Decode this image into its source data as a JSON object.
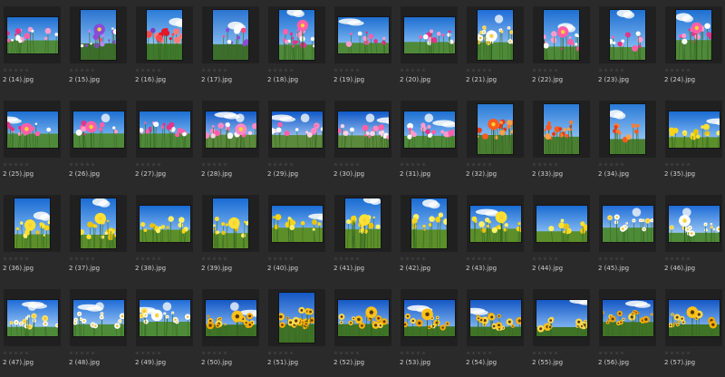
{
  "files": [
    {
      "name": "2 (14).jpg",
      "theme": "cosmos",
      "portrait": false
    },
    {
      "name": "2 (15).jpg",
      "theme": "purple",
      "portrait": true
    },
    {
      "name": "2 (16).jpg",
      "theme": "tulip",
      "portrait": true
    },
    {
      "name": "2 (17).jpg",
      "theme": "purple",
      "portrait": true
    },
    {
      "name": "2 (18).jpg",
      "theme": "cosmos",
      "portrait": true
    },
    {
      "name": "2 (19).jpg",
      "theme": "cosmos",
      "portrait": false
    },
    {
      "name": "2 (20).jpg",
      "theme": "cosmos",
      "portrait": false
    },
    {
      "name": "2 (21).jpg",
      "theme": "white",
      "portrait": true
    },
    {
      "name": "2 (22).jpg",
      "theme": "cosmos",
      "portrait": true
    },
    {
      "name": "2 (23).jpg",
      "theme": "cosmos",
      "portrait": true
    },
    {
      "name": "2 (24).jpg",
      "theme": "cosmos",
      "portrait": true
    },
    {
      "name": "2 (25).jpg",
      "theme": "cosmos",
      "portrait": false
    },
    {
      "name": "2 (26).jpg",
      "theme": "cosmos",
      "portrait": false
    },
    {
      "name": "2 (27).jpg",
      "theme": "cosmos",
      "portrait": false
    },
    {
      "name": "2 (28).jpg",
      "theme": "sky",
      "portrait": false
    },
    {
      "name": "2 (29).jpg",
      "theme": "sky",
      "portrait": false
    },
    {
      "name": "2 (30).jpg",
      "theme": "sky",
      "portrait": false
    },
    {
      "name": "2 (31).jpg",
      "theme": "cosmos",
      "portrait": false
    },
    {
      "name": "2 (32).jpg",
      "theme": "orange",
      "portrait": true
    },
    {
      "name": "2 (33).jpg",
      "theme": "orange",
      "portrait": true
    },
    {
      "name": "2 (34).jpg",
      "theme": "orange",
      "portrait": true
    },
    {
      "name": "2 (35).jpg",
      "theme": "rape",
      "portrait": false
    },
    {
      "name": "2 (36).jpg",
      "theme": "rape",
      "portrait": true
    },
    {
      "name": "2 (37).jpg",
      "theme": "rape",
      "portrait": true
    },
    {
      "name": "2 (38).jpg",
      "theme": "rape",
      "portrait": false
    },
    {
      "name": "2 (39).jpg",
      "theme": "rape",
      "portrait": true
    },
    {
      "name": "2 (40).jpg",
      "theme": "rape",
      "portrait": false
    },
    {
      "name": "2 (41).jpg",
      "theme": "rape",
      "portrait": true
    },
    {
      "name": "2 (42).jpg",
      "theme": "rape",
      "portrait": true
    },
    {
      "name": "2 (43).jpg",
      "theme": "rape",
      "portrait": false
    },
    {
      "name": "2 (44).jpg",
      "theme": "rape",
      "portrait": false
    },
    {
      "name": "2 (45).jpg",
      "theme": "white",
      "portrait": false
    },
    {
      "name": "2 (46).jpg",
      "theme": "white",
      "portrait": false
    },
    {
      "name": "2 (47).jpg",
      "theme": "white",
      "portrait": false
    },
    {
      "name": "2 (48).jpg",
      "theme": "white",
      "portrait": false
    },
    {
      "name": "2 (49).jpg",
      "theme": "white",
      "portrait": false
    },
    {
      "name": "2 (50).jpg",
      "theme": "sunflower",
      "portrait": false
    },
    {
      "name": "2 (51).jpg",
      "theme": "sunflower",
      "portrait": true
    },
    {
      "name": "2 (52).jpg",
      "theme": "sunflower",
      "portrait": false
    },
    {
      "name": "2 (53).jpg",
      "theme": "sunflower",
      "portrait": false
    },
    {
      "name": "2 (54).jpg",
      "theme": "sunflower",
      "portrait": false
    },
    {
      "name": "2 (55).jpg",
      "theme": "sunflower",
      "portrait": false
    },
    {
      "name": "2 (56).jpg",
      "theme": "sunflower",
      "portrait": false
    },
    {
      "name": "2 (57).jpg",
      "theme": "sunflower",
      "portrait": false
    }
  ],
  "rating_max": 5,
  "colors": {
    "background": "#2a2a2a",
    "tile": "#202020",
    "label": "#d0d0d0",
    "star_empty": "#3f3f3f"
  }
}
